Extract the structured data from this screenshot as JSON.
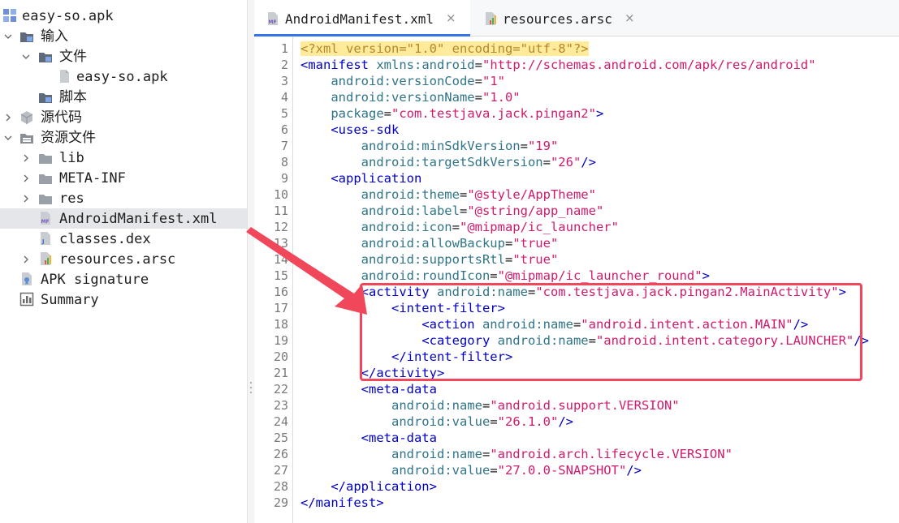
{
  "sidebar": {
    "root": "easy-so.apk",
    "input": "输入",
    "files_folder": "文件",
    "apk_file": "easy-so.apk",
    "scripts": "脚本",
    "source_code": "源代码",
    "resources": "资源文件",
    "lib": "lib",
    "meta_inf": "META-INF",
    "res": "res",
    "manifest": "AndroidManifest.xml",
    "classes": "classes.dex",
    "arsc": "resources.arsc",
    "apk_signature": "APK signature",
    "summary": "Summary"
  },
  "tabs": [
    {
      "label": "AndroidManifest.xml",
      "close": "×",
      "icon": "manifest-file-icon"
    },
    {
      "label": "resources.arsc",
      "close": "×",
      "icon": "arsc-file-icon"
    }
  ],
  "editor": {
    "line_numbers": [
      "1",
      "2",
      "3",
      "4",
      "5",
      "6",
      "7",
      "8",
      "9",
      "10",
      "11",
      "12",
      "13",
      "14",
      "15",
      "16",
      "17",
      "18",
      "19",
      "20",
      "21",
      "22",
      "23",
      "24",
      "25",
      "26",
      "27",
      "28",
      "29"
    ],
    "lines": [
      [
        [
          "pi",
          "<?xml version=\"1.0\" encoding=\"utf-8\"?>"
        ]
      ],
      [
        [
          "tag",
          "<manifest "
        ],
        [
          "attr",
          "xmlns:android"
        ],
        [
          "pun",
          "="
        ],
        [
          "val",
          "\"http://schemas.android.com/apk/res/android\""
        ]
      ],
      [
        [
          "pun",
          "    "
        ],
        [
          "attr",
          "android:versionCode"
        ],
        [
          "pun",
          "="
        ],
        [
          "val",
          "\"1\""
        ]
      ],
      [
        [
          "pun",
          "    "
        ],
        [
          "attr",
          "android:versionName"
        ],
        [
          "pun",
          "="
        ],
        [
          "val",
          "\"1.0\""
        ]
      ],
      [
        [
          "pun",
          "    "
        ],
        [
          "attr",
          "package"
        ],
        [
          "pun",
          "="
        ],
        [
          "val",
          "\"com.testjava.jack.pingan2\""
        ],
        [
          "tag",
          ">"
        ]
      ],
      [
        [
          "pun",
          "    "
        ],
        [
          "tag",
          "<uses-sdk"
        ]
      ],
      [
        [
          "pun",
          "        "
        ],
        [
          "attr",
          "android:minSdkVersion"
        ],
        [
          "pun",
          "="
        ],
        [
          "val",
          "\"19\""
        ]
      ],
      [
        [
          "pun",
          "        "
        ],
        [
          "attr",
          "android:targetSdkVersion"
        ],
        [
          "pun",
          "="
        ],
        [
          "val",
          "\"26\""
        ],
        [
          "tag",
          "/>"
        ]
      ],
      [
        [
          "pun",
          "    "
        ],
        [
          "tag",
          "<application"
        ]
      ],
      [
        [
          "pun",
          "        "
        ],
        [
          "attr",
          "android:theme"
        ],
        [
          "pun",
          "="
        ],
        [
          "val",
          "\"@style/AppTheme\""
        ]
      ],
      [
        [
          "pun",
          "        "
        ],
        [
          "attr",
          "android:label"
        ],
        [
          "pun",
          "="
        ],
        [
          "val",
          "\"@string/app_name\""
        ]
      ],
      [
        [
          "pun",
          "        "
        ],
        [
          "attr",
          "android:icon"
        ],
        [
          "pun",
          "="
        ],
        [
          "val",
          "\"@mipmap/ic_launcher\""
        ]
      ],
      [
        [
          "pun",
          "        "
        ],
        [
          "attr",
          "android:allowBackup"
        ],
        [
          "pun",
          "="
        ],
        [
          "val",
          "\"true\""
        ]
      ],
      [
        [
          "pun",
          "        "
        ],
        [
          "attr",
          "android:supportsRtl"
        ],
        [
          "pun",
          "="
        ],
        [
          "val",
          "\"true\""
        ]
      ],
      [
        [
          "pun",
          "        "
        ],
        [
          "attr",
          "android:roundIcon"
        ],
        [
          "pun",
          "="
        ],
        [
          "val",
          "\"@mipmap/ic_launcher_round\""
        ],
        [
          "tag",
          ">"
        ]
      ],
      [
        [
          "pun",
          "        "
        ],
        [
          "tag",
          "<activity "
        ],
        [
          "attr",
          "android:name"
        ],
        [
          "pun",
          "="
        ],
        [
          "val",
          "\"com.testjava.jack.pingan2.MainActivity\""
        ],
        [
          "tag",
          ">"
        ]
      ],
      [
        [
          "pun",
          "            "
        ],
        [
          "tag",
          "<intent-filter>"
        ]
      ],
      [
        [
          "pun",
          "                "
        ],
        [
          "tag",
          "<action "
        ],
        [
          "attr",
          "android:name"
        ],
        [
          "pun",
          "="
        ],
        [
          "val",
          "\"android.intent.action.MAIN\""
        ],
        [
          "tag",
          "/>"
        ]
      ],
      [
        [
          "pun",
          "                "
        ],
        [
          "tag",
          "<category "
        ],
        [
          "attr",
          "android:name"
        ],
        [
          "pun",
          "="
        ],
        [
          "val",
          "\"android.intent.category.LAUNCHER\""
        ],
        [
          "tag",
          "/>"
        ]
      ],
      [
        [
          "pun",
          "            "
        ],
        [
          "tag",
          "</intent-filter>"
        ]
      ],
      [
        [
          "pun",
          "        "
        ],
        [
          "tag",
          "</activity>"
        ]
      ],
      [
        [
          "pun",
          "        "
        ],
        [
          "tag",
          "<meta-data"
        ]
      ],
      [
        [
          "pun",
          "            "
        ],
        [
          "attr",
          "android:name"
        ],
        [
          "pun",
          "="
        ],
        [
          "val",
          "\"android.support.VERSION\""
        ]
      ],
      [
        [
          "pun",
          "            "
        ],
        [
          "attr",
          "android:value"
        ],
        [
          "pun",
          "="
        ],
        [
          "val",
          "\"26.1.0\""
        ],
        [
          "tag",
          "/>"
        ]
      ],
      [
        [
          "pun",
          "        "
        ],
        [
          "tag",
          "<meta-data"
        ]
      ],
      [
        [
          "pun",
          "            "
        ],
        [
          "attr",
          "android:name"
        ],
        [
          "pun",
          "="
        ],
        [
          "val",
          "\"android.arch.lifecycle.VERSION\""
        ]
      ],
      [
        [
          "pun",
          "            "
        ],
        [
          "attr",
          "android:value"
        ],
        [
          "pun",
          "="
        ],
        [
          "val",
          "\"27.0.0-SNAPSHOT\""
        ],
        [
          "tag",
          "/>"
        ]
      ],
      [
        [
          "pun",
          "    "
        ],
        [
          "tag",
          "</application>"
        ]
      ],
      [
        [
          "tag",
          "</manifest>"
        ]
      ]
    ]
  },
  "colors": {
    "highlight": "#f0485a",
    "tab_active_underline": "#3574f0",
    "xml_tag": "#0000c8",
    "xml_attr": "#2f7488",
    "xml_value": "#d11a6d",
    "selected_row": "#e4e6ea"
  }
}
